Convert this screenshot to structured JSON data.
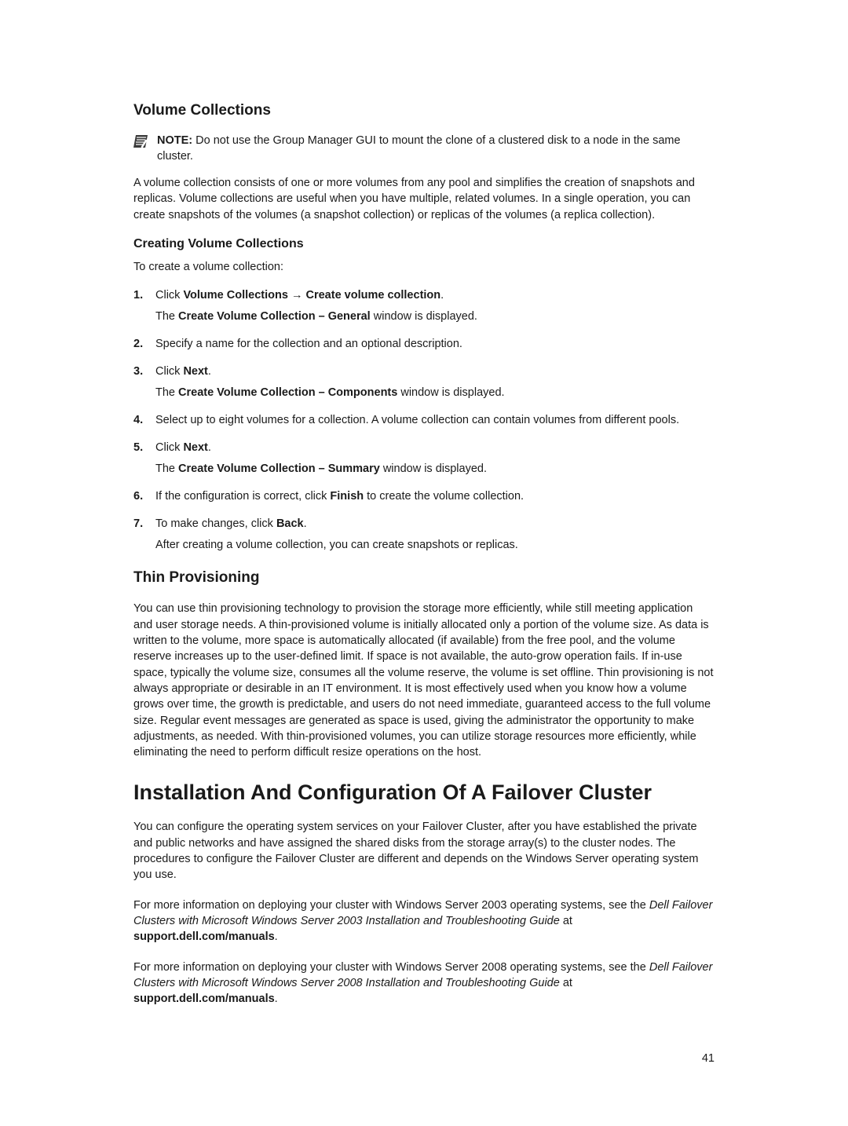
{
  "section1": {
    "heading": "Volume Collections",
    "note_label": "NOTE:",
    "note_body": " Do not use the Group Manager GUI to mount the clone of a clustered disk to a node in the same cluster.",
    "para1": "A volume collection consists of one or more volumes from any pool and simplifies the creation of snapshots and replicas. Volume collections are useful when you have multiple, related volumes. In a single operation, you can create snapshots of the volumes (a snapshot collection) or replicas of the volumes (a replica collection).",
    "sub_heading": "Creating Volume Collections",
    "lead_in": "To create a volume collection:",
    "steps": [
      {
        "n": "1.",
        "pre": "Click ",
        "b1": "Volume Collections ",
        "arrow": "→ ",
        "b2": "Create volume collection",
        "post": ".",
        "sub_pre": "The ",
        "sub_b": "Create Volume Collection – General",
        "sub_post": " window is displayed."
      },
      {
        "n": "2.",
        "text": "Specify a name for the collection and an optional description."
      },
      {
        "n": "3.",
        "pre": "Click ",
        "b1": "Next",
        "post": ".",
        "sub_pre": "The ",
        "sub_b": "Create Volume Collection – Components",
        "sub_post": " window is displayed."
      },
      {
        "n": "4.",
        "text": "Select up to eight volumes for a collection. A volume collection can contain volumes from different pools."
      },
      {
        "n": "5.",
        "pre": "Click ",
        "b1": "Next",
        "post": ".",
        "sub_pre": "The ",
        "sub_b": "Create Volume Collection – Summary",
        "sub_post": " window is displayed."
      },
      {
        "n": "6.",
        "pre": "If the configuration is correct, click ",
        "b1": "Finish",
        "post": " to create the volume collection."
      },
      {
        "n": "7.",
        "pre": "To make changes, click ",
        "b1": "Back",
        "post": ".",
        "sub_text": "After creating a volume collection, you can create snapshots or replicas."
      }
    ]
  },
  "section2": {
    "heading": "Thin Provisioning",
    "para": "You can use thin provisioning technology to provision the storage more efficiently, while still meeting application and user storage needs. A thin-provisioned volume is initially allocated only a portion of the volume size. As data is written to the volume, more space is automatically allocated (if available) from the free pool, and the volume reserve increases up to the user-defined limit. If space is not available, the auto-grow operation fails. If in-use space, typically the volume size, consumes all the volume reserve, the volume is set offline. Thin provisioning is not always appropriate or desirable in an IT environment. It is most effectively used when you know how a volume grows over time, the growth is predictable, and users do not need immediate, guaranteed access to the full volume size. Regular event messages are generated as space is used, giving the administrator the opportunity to make adjustments, as needed. With thin-provisioned volumes, you can utilize storage resources more efficiently, while eliminating the need to perform difficult resize operations on the host."
  },
  "section3": {
    "heading": "Installation And Configuration Of A Failover Cluster",
    "para1": "You can configure the operating system services on your Failover Cluster, after you have established the private and public networks and have assigned the shared disks from the storage array(s) to the cluster nodes. The procedures to configure the Failover Cluster are different and depends on the Windows Server operating system you use.",
    "para2_pre": "For more information on deploying your cluster with Windows Server 2003 operating systems, see the ",
    "para2_i": "Dell Failover Clusters with Microsoft Windows Server 2003 Installation and Troubleshooting Guide",
    "para2_mid": " at ",
    "para2_b": "support.dell.com/manuals",
    "para2_post": ".",
    "para3_pre": "For more information on deploying your cluster with Windows Server 2008 operating systems, see the ",
    "para3_i": "Dell Failover Clusters with Microsoft Windows Server 2008 Installation and Troubleshooting Guide",
    "para3_mid": " at ",
    "para3_b": "support.dell.com/manuals",
    "para3_post": "."
  },
  "page_number": "41"
}
